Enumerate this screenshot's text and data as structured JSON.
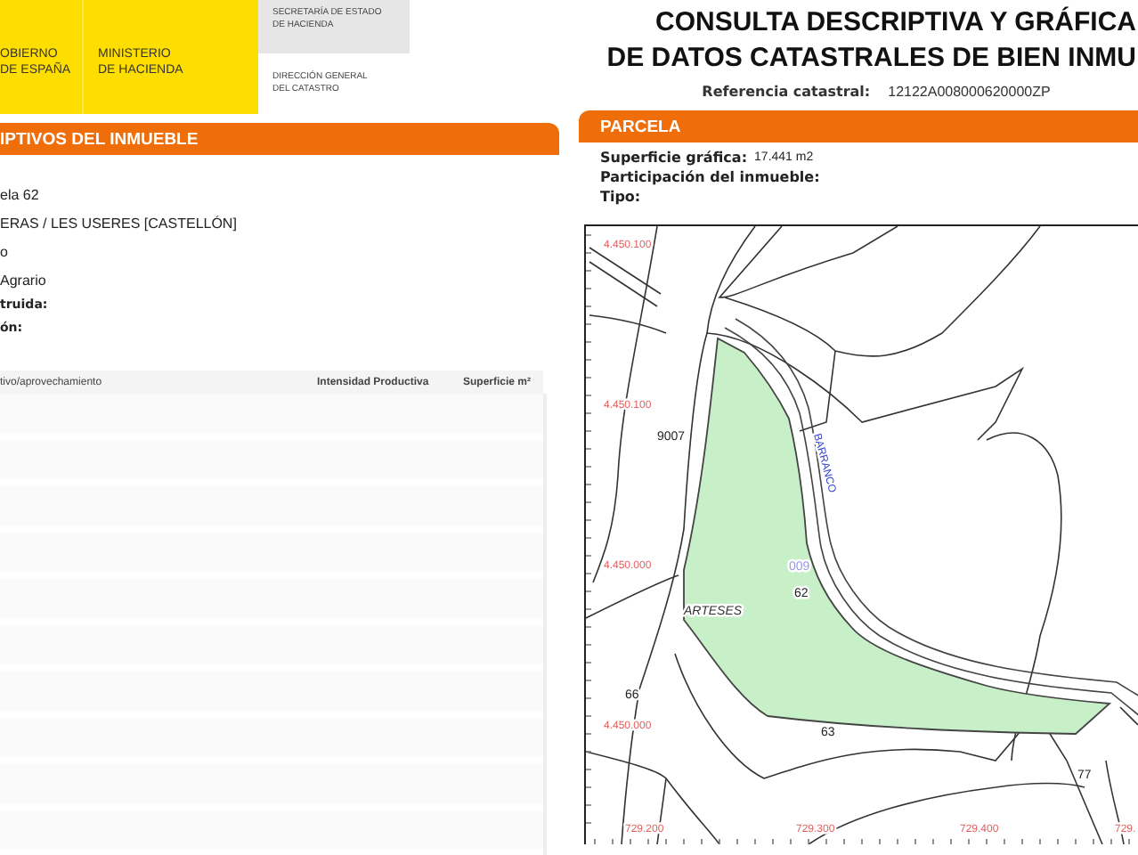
{
  "header": {
    "logo": {
      "government": [
        "OBIERNO",
        "DE ESPAÑA"
      ],
      "ministry": [
        "MINISTERIO",
        "DE HACIENDA"
      ],
      "secretariat": [
        "SECRETARÍA DE ESTADO",
        "DE HACIENDA"
      ],
      "directorate": [
        "DIRECCIÓN GENERAL",
        "DEL CATASTRO"
      ]
    },
    "title": [
      "CONSULTA DESCRIPTIVA Y GRÁFICA",
      "DE DATOS CATASTRALES DE BIEN INMU"
    ],
    "reference": {
      "label": "Referencia catastral:",
      "value": "12122A008000620000ZP"
    }
  },
  "left_panel": {
    "heading": "IPTIVOS DEL INMUEBLE",
    "lines": [
      {
        "text": "ela 62",
        "bold": false
      },
      {
        "text": "ERAS / LES USERES [CASTELLÓN]",
        "bold": false
      },
      {
        "text": "o",
        "bold": false
      },
      {
        "text": "Agrario",
        "bold": false
      },
      {
        "text": "truida:",
        "bold": true
      },
      {
        "text": "ón:",
        "bold": true
      }
    ],
    "table": {
      "columns": [
        "tivo/aprovechamiento",
        "Intensidad Productiva",
        "Superficie m²"
      ]
    }
  },
  "right_panel": {
    "heading": "PARCELA",
    "fields": [
      {
        "label": "Superficie gráfica:",
        "value": "17.441 m2"
      },
      {
        "label": "Participación del inmueble:"
      },
      {
        "label": "Tipo:"
      }
    ],
    "map": {
      "y_labels": [
        "4.450.100",
        "4.450.100",
        "4.450.000",
        "4.450.000"
      ],
      "x_labels": [
        "729.200",
        "729.300",
        "729.400",
        "729."
      ],
      "labels": [
        {
          "kind": "parcel",
          "text": "9007"
        },
        {
          "kind": "stream",
          "text": "BARRANCO"
        },
        {
          "kind": "polygon",
          "text": "009"
        },
        {
          "kind": "parcel",
          "text": "62"
        },
        {
          "kind": "place",
          "text": "ARTESES"
        },
        {
          "kind": "parcel",
          "text": "66"
        },
        {
          "kind": "parcel",
          "text": "63"
        },
        {
          "kind": "parcel",
          "text": "77"
        }
      ]
    }
  }
}
